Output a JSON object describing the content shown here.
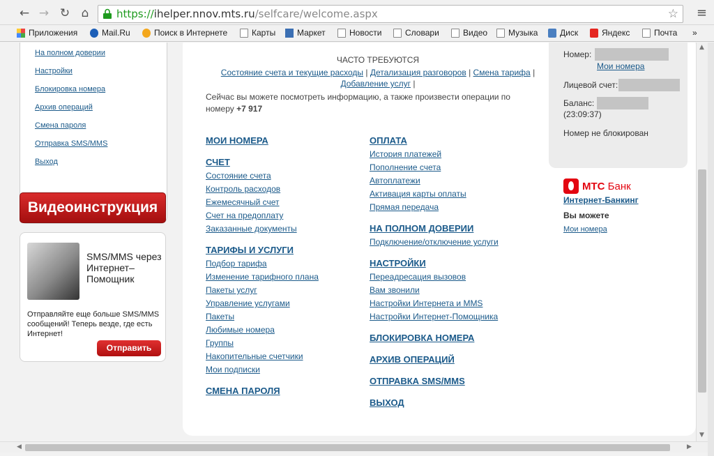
{
  "browser": {
    "url_scheme": "https://",
    "url_host": "ihelper.nnov.mts.ru",
    "url_path": "/selfcare/welcome.aspx",
    "nav_icons": [
      "back-arrow-icon",
      "forward-arrow-icon",
      "reload-icon",
      "home-icon"
    ],
    "bookmarks": [
      "Приложения",
      "Mail.Ru",
      "Поиск в Интернете",
      "Карты",
      "Маркет",
      "Новости",
      "Словари",
      "Видео",
      "Музыка",
      "Диск",
      "Яндекс",
      "Почта"
    ],
    "more": "»"
  },
  "sidebar": {
    "links": [
      "На полном доверии",
      "Настройки",
      "Блокировка номера",
      "Архив операций",
      "Смена пароля",
      "Отправка SMS/MMS",
      "Выход"
    ]
  },
  "video_button": "Видеоинструкция",
  "promo": {
    "title": "SMS/MMS через Интернет–Помощник",
    "text": "Отправляйте еще больше SMS/MMS сообщений! Теперь везде, где есть Интернет!",
    "button": "Отправить"
  },
  "frequent": {
    "title": "ЧАСТО ТРЕБУЮТСЯ",
    "links": [
      "Состояние счета и текущие расходы",
      "Детализация разговоров",
      "Смена тарифа",
      "Добавление услуг"
    ],
    "separator": "|"
  },
  "description": {
    "text": "Сейчас вы можете посмотреть информацию, а также произвести операции по номеру",
    "number": "+7 917"
  },
  "left_column": {
    "my_numbers": "МОИ НОМЕРА",
    "account": {
      "title": "СЧЕТ",
      "items": [
        "Состояние счета",
        "Контроль расходов",
        "Ежемесячный счет",
        "Счет на предоплату",
        "Заказанные документы"
      ]
    },
    "tariffs": {
      "title": "ТАРИФЫ И УСЛУГИ",
      "items": [
        "Подбор тарифа",
        "Изменение тарифного плана",
        "Пакеты услуг",
        "Управление услугами",
        "Пакеты",
        "Любимые номера",
        "Группы",
        "Накопительные счетчики",
        "Мои подписки"
      ]
    },
    "password": "СМЕНА ПАРОЛЯ"
  },
  "right_column": {
    "payment": {
      "title": "ОПЛАТА",
      "items": [
        "История платежей",
        "Пополнение счета",
        "Автоплатежи",
        "Активация карты оплаты",
        "Прямая передача"
      ]
    },
    "trust": {
      "title": "НА ПОЛНОМ ДОВЕРИИ",
      "items": [
        "Подключение/отключение услуги"
      ]
    },
    "settings": {
      "title": "НАСТРОЙКИ",
      "items": [
        "Переадресация вызовов",
        "Вам звонили",
        "Настройки Интернета и MMS",
        "Настройки Интернет-Помощника"
      ]
    },
    "block": "БЛОКИРОВКА НОМЕРА",
    "archive": "АРХИВ ОПЕРАЦИЙ",
    "sms": "ОТПРАВКА SMS/MMS",
    "exit": "ВЫХОД"
  },
  "account_box": {
    "number_label": "Номер:",
    "my_numbers_link": "Мои номера",
    "personal_account_label": "Лицевой счет:",
    "balance_label": "Баланс:",
    "balance_time": "(23:09:37)",
    "status": "Номер не блокирован"
  },
  "bank": {
    "name_bold": "МТС",
    "name_thin": "Банк",
    "link": "Интернет-Банкинг",
    "can": "Вы можете",
    "numbers_link": "Мои номера"
  }
}
